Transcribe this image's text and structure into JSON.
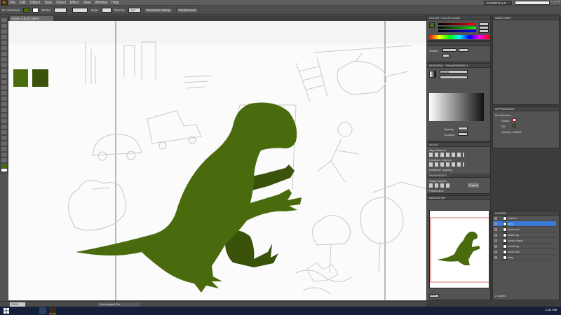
{
  "app": {
    "logo": "Ai",
    "menu": [
      "File",
      "Edit",
      "Object",
      "Type",
      "Select",
      "Effect",
      "View",
      "Window",
      "Help"
    ],
    "workspace": "ESSENTIALS",
    "window_controls": [
      "–",
      "□",
      "×"
    ]
  },
  "control_bar": {
    "selection": "No Selection",
    "stroke_label": "Stroke:",
    "style_label": "Style:",
    "opacity_label": "Opacity:",
    "opacity_value": "100",
    "document_setup": "Document Setup",
    "preferences": "Preferences"
  },
  "document": {
    "tab": "Action 2.ai @ 200% (RGB/Preview)"
  },
  "status_bar": {
    "zoom": "200%",
    "status": "Unmanaged File"
  },
  "panels": {
    "color": {
      "tabs": [
        "COLOR",
        "COLOR GUIDE"
      ]
    },
    "stroke": {
      "weight_label": "Weight:"
    },
    "gradient": {
      "tabs": [
        "GRADIENT",
        "TRANSPARENCY"
      ],
      "type": "Linear",
      "opacity_label": "Opacity:",
      "location_label": "Location:"
    },
    "swatches": {
      "tabs": [
        "SWATCHES",
        "BRUSHES",
        "SYMBOLS"
      ]
    },
    "appearance": {
      "tabs": [
        "APPEARANCE",
        "GRAPHIC STYLES"
      ],
      "title": "No Selection",
      "rows": [
        "Stroke:",
        "Fill:",
        "Opacity: Default"
      ]
    },
    "align": {
      "tabs": [
        "ALIGN",
        "PATHFINDER"
      ],
      "align_objects": "Align Objects:",
      "distribute_objects": "Distribute Objects:",
      "distribute_spacing": "Distribute Spacing:",
      "shape_modes": "Shape Modes:",
      "pathfinders": "Pathfinders:",
      "expand": "Expand"
    },
    "navigator": {
      "tab": "NAVIGATOR",
      "zoom": "200%"
    },
    "layers": {
      "tab": "LAYERS",
      "rows": [
        "sketch",
        "dino",
        "front arm",
        "back leg",
        "body shape",
        "back leg",
        "back arm",
        "bkg"
      ],
      "footer": "2 Layers"
    }
  },
  "taskbar": {
    "time": "1:31 AM"
  },
  "colors": {
    "dino_main": "#4a6b0d",
    "dino_dark": "#3a5209",
    "accent_selected": "#3a7bd5",
    "navigator_frame": "#d04040"
  }
}
